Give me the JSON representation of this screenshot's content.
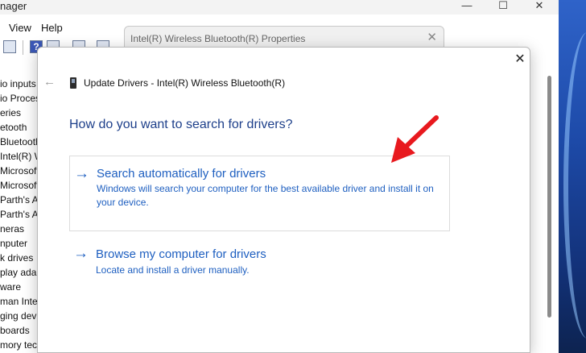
{
  "device_manager": {
    "title": "nager",
    "window_controls": [
      "—",
      "☐",
      "✕"
    ],
    "menu": [
      "View",
      "Help"
    ],
    "tree_items": [
      "io inputs",
      "io Proces",
      "eries",
      "etooth",
      "Bluetooth",
      "Intel(R) W",
      "Microsoft",
      "Microsoft",
      "Parth's Ai",
      "Parth's Ai",
      "neras",
      "nputer",
      "k drives",
      "play adapt",
      "ware",
      "man Inter",
      "ging devi",
      "boards",
      "mory tech"
    ]
  },
  "properties_window": {
    "title": "Intel(R) Wireless Bluetooth(R) Properties",
    "close": "✕"
  },
  "dialog": {
    "close": "✕",
    "back": "←",
    "heading": "Update Drivers - Intel(R) Wireless Bluetooth(R)",
    "question": "How do you want to search for drivers?",
    "options": [
      {
        "arrow": "→",
        "title": "Search automatically for drivers",
        "description": "Windows will search your computer for the best available driver and install it on your device."
      },
      {
        "arrow": "→",
        "title": "Browse my computer for drivers",
        "description": "Locate and install a driver manually."
      }
    ]
  },
  "colors": {
    "accent_link": "#1e5fc0",
    "question": "#1d3f8a",
    "annotation": "#e8191e"
  }
}
